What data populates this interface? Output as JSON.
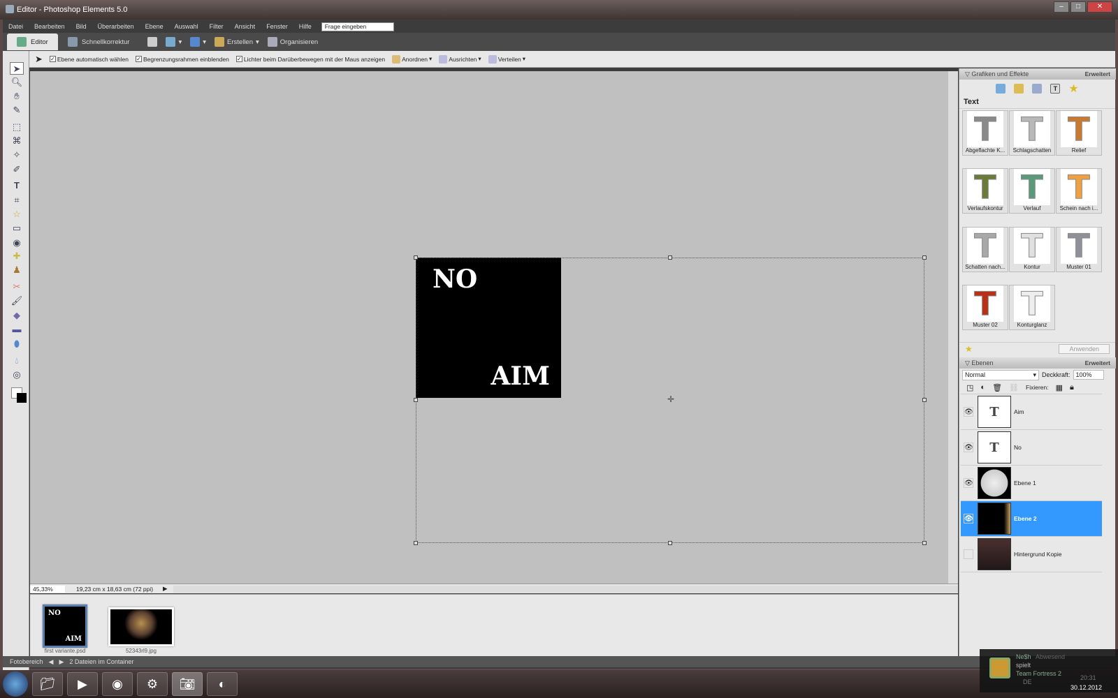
{
  "window": {
    "title": "Editor - Photoshop Elements 5.0"
  },
  "menu": [
    "Datei",
    "Bearbeiten",
    "Bild",
    "Überarbeiten",
    "Ebene",
    "Auswahl",
    "Filter",
    "Ansicht",
    "Fenster",
    "Hilfe"
  ],
  "search": {
    "placeholder": "Frage eingeben"
  },
  "tabs": {
    "editor": "Editor",
    "quickfix": "Schnellkorrektur",
    "create": "Erstellen",
    "organize": "Organisieren"
  },
  "options": {
    "auto_select": "Ebene automatisch wählen",
    "show_bbox": "Begrenzungsrahmen einblenden",
    "highlight": "Lichter beim Darüberbewegen mit der Maus anzeigen",
    "arrange": "Anordnen",
    "align": "Ausrichten",
    "distribute": "Verteilen"
  },
  "document": {
    "text_top": "NO",
    "text_bottom": "AIM"
  },
  "status": {
    "zoom": "45,33%",
    "size": "19,23 cm x 18,63 cm (72 ppi)"
  },
  "photobin": {
    "items": [
      {
        "name": "first variante.psd"
      },
      {
        "name": "52343rl9.jpg"
      }
    ],
    "label": "Fotobereich",
    "count": "2 Dateien im Container"
  },
  "effects": {
    "title": "Grafiken und Effekte",
    "more": "Erweitert",
    "category": "Text",
    "apply": "Anwenden",
    "items": [
      {
        "label": "Abgeflachte K...",
        "color": "#8a8a8a"
      },
      {
        "label": "Schlagschatten",
        "color": "#b8b8b8"
      },
      {
        "label": "Relief",
        "color": "#c87a30"
      },
      {
        "label": "Verlaufskontur",
        "color": "#6a7a3a"
      },
      {
        "label": "Verlauf",
        "color": "#5a9a7a"
      },
      {
        "label": "Schein nach i...",
        "color": "#f0a040"
      },
      {
        "label": "Schatten nach...",
        "color": "#a8a8a8"
      },
      {
        "label": "Kontur",
        "color": "#e0e0e0"
      },
      {
        "label": "Muster 01",
        "color": "#909098"
      },
      {
        "label": "Muster 02",
        "color": "#b83018"
      },
      {
        "label": "Konturglanz",
        "color": "#eeeeee"
      }
    ]
  },
  "layers": {
    "title": "Ebenen",
    "more": "Erweitert",
    "blend": "Normal",
    "opacity_label": "Deckkraft:",
    "opacity": "100%",
    "lock_label": "Fixieren:",
    "items": [
      {
        "name": "Aim",
        "visible": true
      },
      {
        "name": "No",
        "visible": true
      },
      {
        "name": "Ebene 1",
        "visible": true
      },
      {
        "name": "Ebene 2",
        "visible": true,
        "selected": true
      },
      {
        "name": "Hintergrund Kopie",
        "visible": false
      }
    ]
  },
  "notification": {
    "user": "Ne$h",
    "status": "Abwesend",
    "action": "spielt",
    "game": "Team Fortress 2",
    "lang": "DE",
    "time": "20:31",
    "date": "30.12.2012"
  }
}
